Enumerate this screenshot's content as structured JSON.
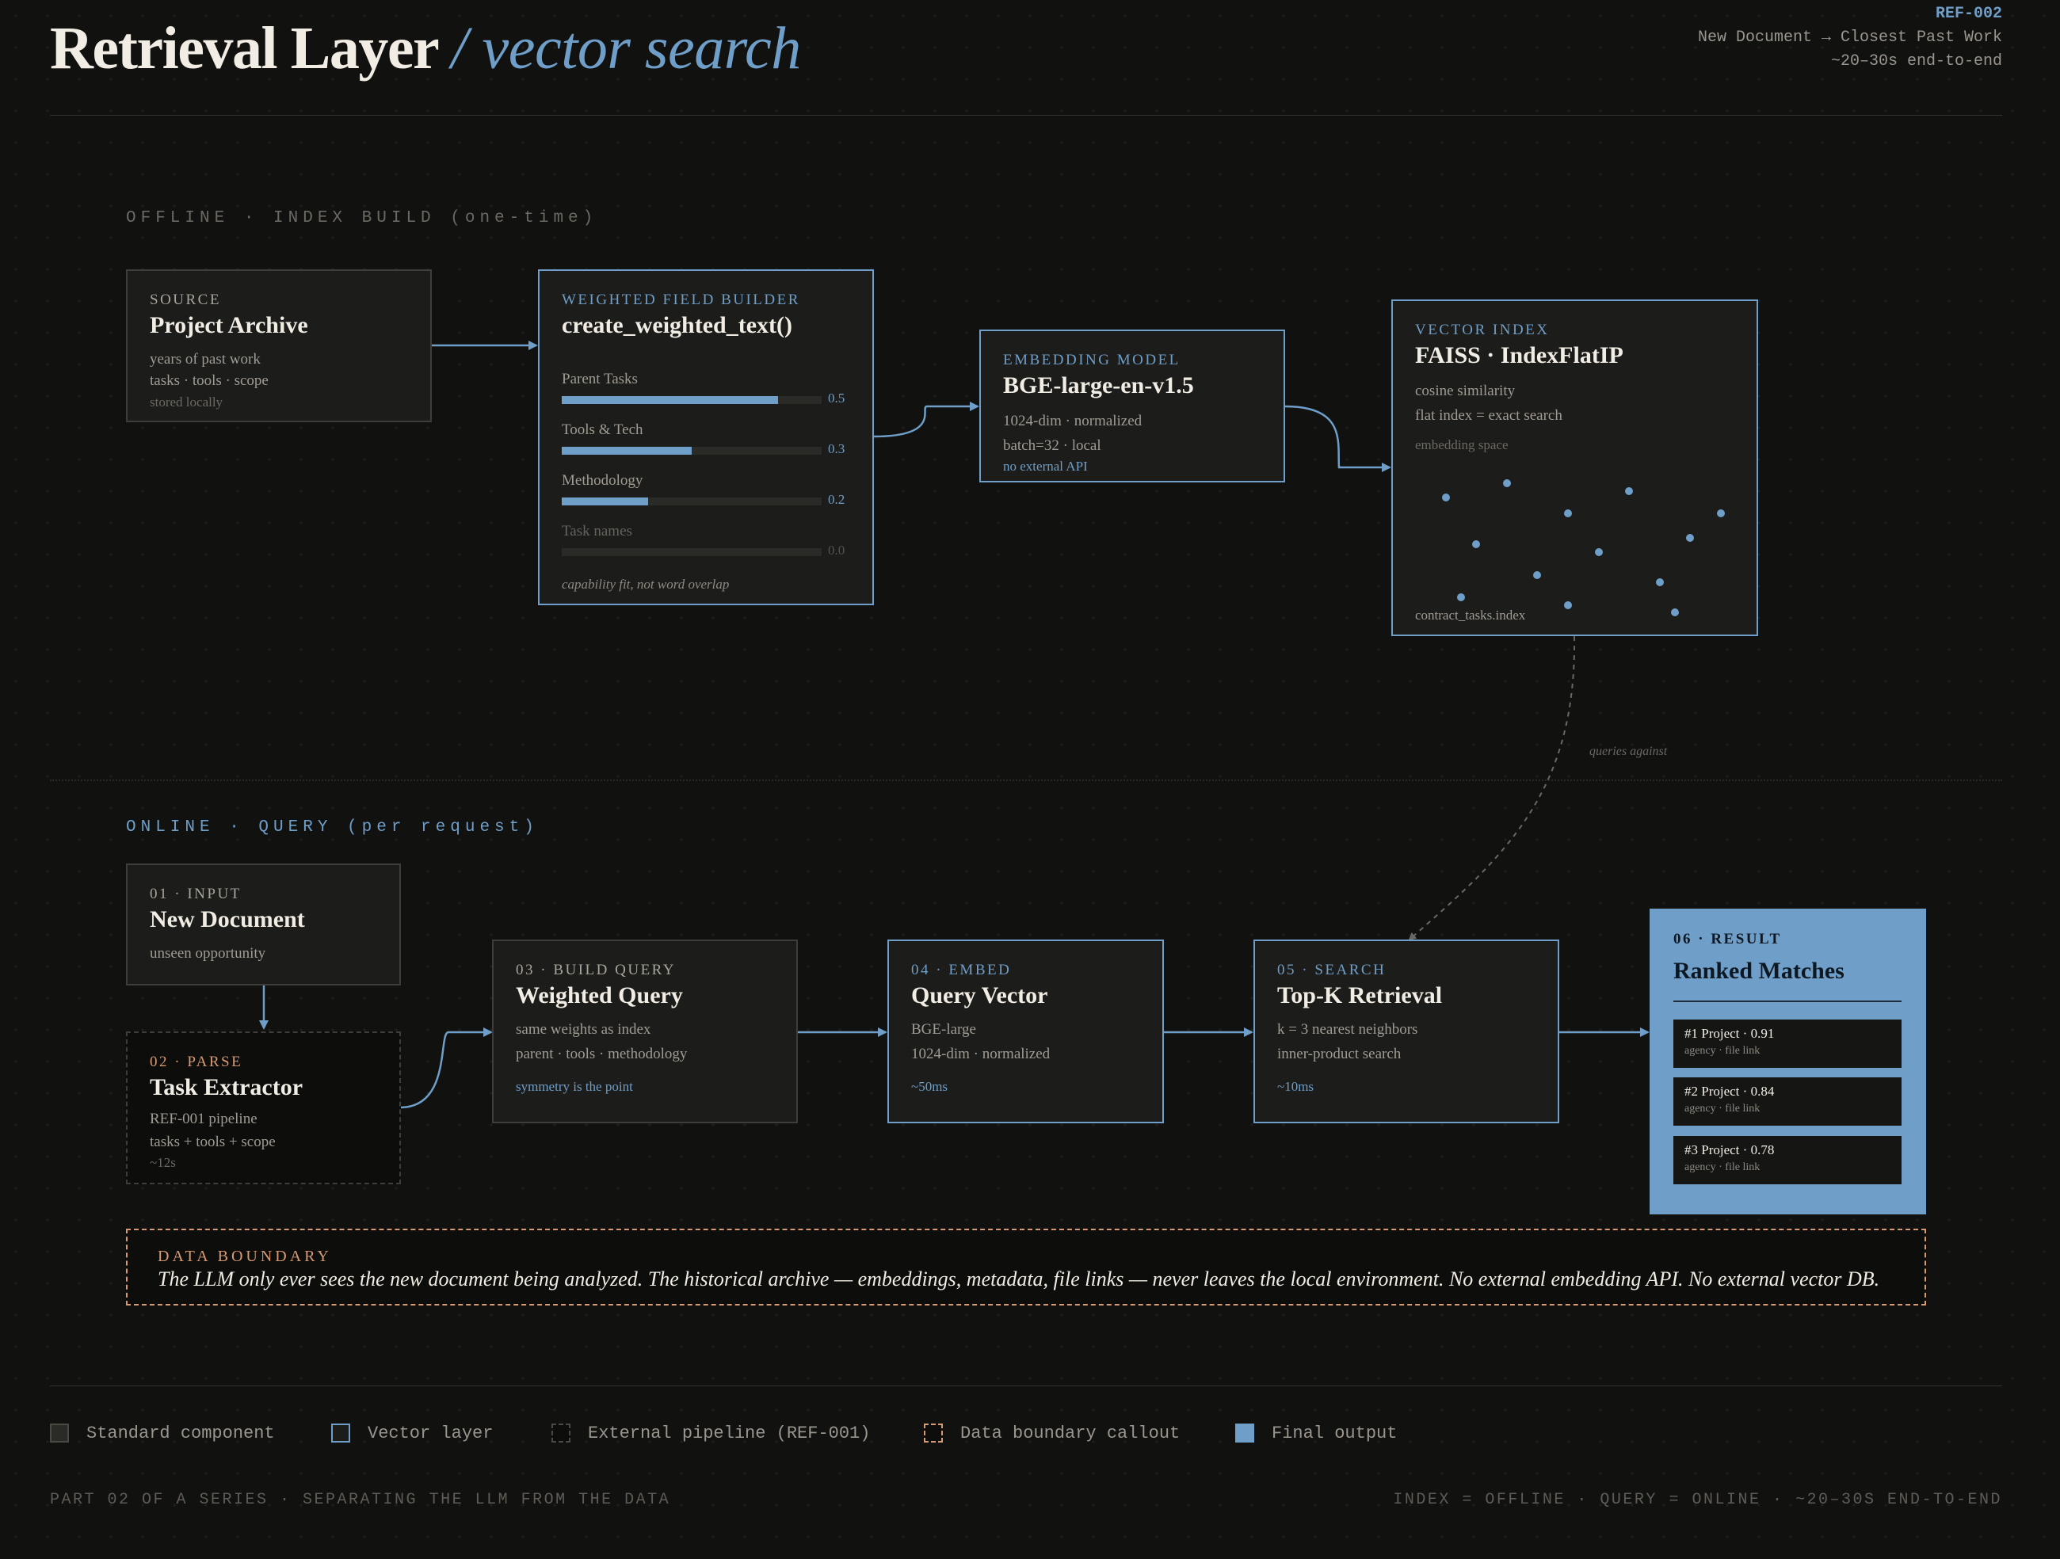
{
  "header": {
    "title": "Retrieval Layer",
    "subtitle": "/ vector search",
    "ref": "REF-002",
    "meta_line1": "New Document → Closest Past Work",
    "meta_line2": "~20–30s end-to-end"
  },
  "sections": {
    "offline": "OFFLINE · INDEX BUILD (one-time)",
    "online": "ONLINE · QUERY (per request)"
  },
  "offline": {
    "source": {
      "kicker": "SOURCE",
      "title": "Project Archive",
      "lines": [
        "years of past work",
        "tasks · tools · scope"
      ],
      "note": "stored locally"
    },
    "builder": {
      "kicker": "WEIGHTED FIELD BUILDER",
      "title": "create_weighted_text()",
      "fields": [
        {
          "label": "Parent Tasks",
          "weight": 0.5,
          "value_label": "0.5"
        },
        {
          "label": "Tools & Tech",
          "weight": 0.3,
          "value_label": "0.3"
        },
        {
          "label": "Methodology",
          "weight": 0.2,
          "value_label": "0.2"
        },
        {
          "label": "Task names",
          "weight": 0.0,
          "value_label": "0.0"
        }
      ],
      "caption": "capability fit, not word overlap"
    },
    "embedding": {
      "kicker": "EMBEDDING MODEL",
      "title": "BGE-large-en-v1.5",
      "lines": [
        "1024-dim · normalized",
        "batch=32 · local"
      ],
      "note": "no external API"
    },
    "index": {
      "kicker": "VECTOR INDEX",
      "title": "FAISS · IndexFlatIP",
      "lines": [
        "cosine similarity",
        "flat index = exact search"
      ],
      "space_label": "embedding space",
      "file": "contract_tasks.index"
    }
  },
  "connector_label": "queries against",
  "online": {
    "input": {
      "kicker": "01 · INPUT",
      "title": "New Document",
      "lines": [
        "unseen opportunity"
      ]
    },
    "parse": {
      "kicker": "02 · PARSE",
      "title": "Task Extractor",
      "lines": [
        "REF-001 pipeline",
        "tasks + tools + scope"
      ],
      "note": "~12s"
    },
    "build_query": {
      "kicker": "03 · BUILD QUERY",
      "title": "Weighted Query",
      "lines": [
        "same weights as index",
        "parent · tools · methodology"
      ],
      "note": "symmetry is the point"
    },
    "embed": {
      "kicker": "04 · EMBED",
      "title": "Query Vector",
      "lines": [
        "BGE-large",
        "1024-dim · normalized"
      ],
      "note": "~50ms"
    },
    "search": {
      "kicker": "05 · SEARCH",
      "title": "Top-K Retrieval",
      "lines": [
        "k = 3 nearest neighbors",
        "inner-product search"
      ],
      "note": "~10ms"
    },
    "result": {
      "kicker": "06 · RESULT",
      "title": "Ranked Matches",
      "matches": [
        {
          "label": "#1 Project · 0.91",
          "sub": "agency · file link"
        },
        {
          "label": "#2 Project · 0.84",
          "sub": "agency · file link"
        },
        {
          "label": "#3 Project · 0.78",
          "sub": "agency · file link"
        }
      ]
    }
  },
  "boundary": {
    "kicker": "DATA BOUNDARY",
    "text": "The LLM only ever sees the new document being analyzed. The historical archive — embeddings, metadata, file links — never leaves the local environment. No external embedding API. No external vector DB."
  },
  "legend": [
    {
      "label": "Standard component",
      "style": "standard"
    },
    {
      "label": "Vector layer",
      "style": "vector"
    },
    {
      "label": "External pipeline (REF-001)",
      "style": "external"
    },
    {
      "label": "Data boundary callout",
      "style": "boundary"
    },
    {
      "label": "Final output",
      "style": "output"
    }
  ],
  "footer": {
    "left": "PART 02 OF A SERIES · SEPARATING THE LLM FROM THE DATA",
    "right": "INDEX = OFFLINE · QUERY = ONLINE · ~20–30S END-TO-END"
  },
  "colors": {
    "accent": "#6f9ec8",
    "boundary": "#d89a72",
    "background": "#111110"
  }
}
